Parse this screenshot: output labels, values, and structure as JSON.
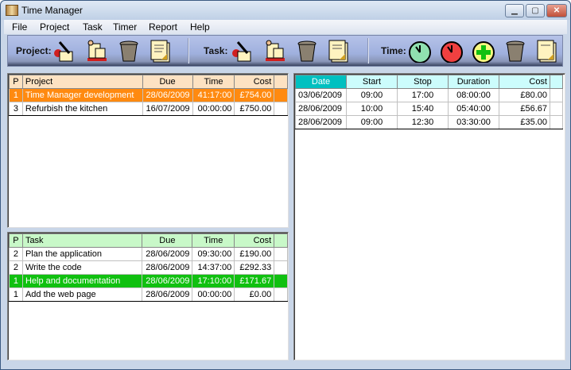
{
  "window": {
    "title": "Time Manager",
    "minimize": "▁",
    "maximize": "▢",
    "close": "✕"
  },
  "menu": [
    "File",
    "Project",
    "Task",
    "Timer",
    "Report",
    "Help"
  ],
  "toolbar": {
    "project_label": "Project:",
    "task_label": "Task:",
    "time_label": "Time:"
  },
  "projects": {
    "headers": [
      "P",
      "Project",
      "Due",
      "Time",
      "Cost"
    ],
    "rows": [
      [
        "1",
        "Time Manager development",
        "28/06/2009",
        "41:17:00",
        "£754.00"
      ],
      [
        "3",
        "Refurbish the kitchen",
        "16/07/2009",
        "00:00:00",
        "£750.00"
      ]
    ],
    "selected": 0
  },
  "tasks": {
    "headers": [
      "P",
      "Task",
      "Due",
      "Time",
      "Cost"
    ],
    "rows": [
      [
        "2",
        "Plan the application",
        "28/06/2009",
        "09:30:00",
        "£190.00"
      ],
      [
        "2",
        "Write the code",
        "28/06/2009",
        "14:37:00",
        "£292.33"
      ],
      [
        "1",
        "Help and documentation",
        "28/06/2009",
        "17:10:00",
        "£171.67"
      ],
      [
        "1",
        "Add the web page",
        "28/06/2009",
        "00:00:00",
        "£0.00"
      ]
    ],
    "selected": 2
  },
  "times": {
    "headers": [
      "Date",
      "Start",
      "Stop",
      "Duration",
      "Cost"
    ],
    "rows": [
      [
        "03/06/2009",
        "09:00",
        "17:00",
        "08:00:00",
        "£80.00"
      ],
      [
        "28/06/2009",
        "10:00",
        "15:40",
        "05:40:00",
        "£56.67"
      ],
      [
        "28/06/2009",
        "09:00",
        "12:30",
        "03:30:00",
        "£35.00"
      ]
    ]
  },
  "colors": {
    "project_sel": "#ff8a10",
    "task_sel": "#10c010",
    "date_header": "#00c0c0"
  }
}
